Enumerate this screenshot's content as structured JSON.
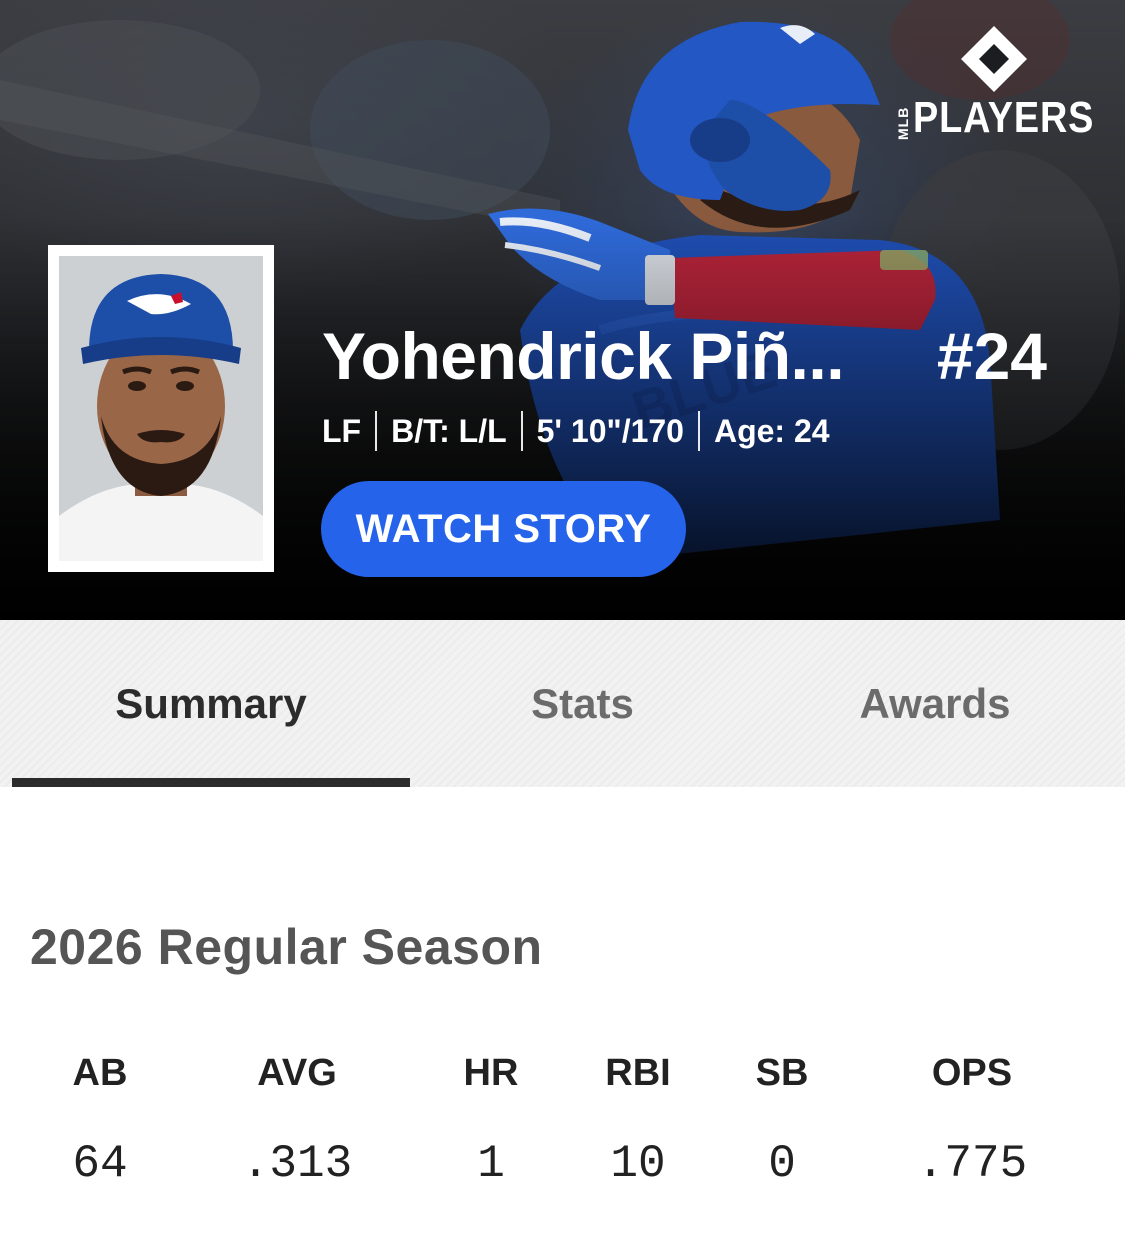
{
  "brand": {
    "mlb": "MLB",
    "name": "PLAYERS"
  },
  "player": {
    "name": "Yohendrick Piñ...",
    "number": "#24",
    "position": "LF",
    "bats_throws": "B/T: L/L",
    "height_weight": "5' 10\"/170",
    "age": "Age: 24"
  },
  "hero": {
    "watch_story_label": "WATCH STORY"
  },
  "tabs": [
    {
      "label": "Summary",
      "active": true
    },
    {
      "label": "Stats",
      "active": false
    },
    {
      "label": "Awards",
      "active": false
    }
  ],
  "season": {
    "title": "2026 Regular Season",
    "headers": [
      "AB",
      "AVG",
      "HR",
      "RBI",
      "SB",
      "OPS"
    ],
    "values": [
      "64",
      ".313",
      "1",
      "10",
      "0",
      ".775"
    ]
  },
  "colors": {
    "accent": "#2563eb",
    "cap": "#1d4ea8",
    "sleeve": "#b7243a"
  }
}
